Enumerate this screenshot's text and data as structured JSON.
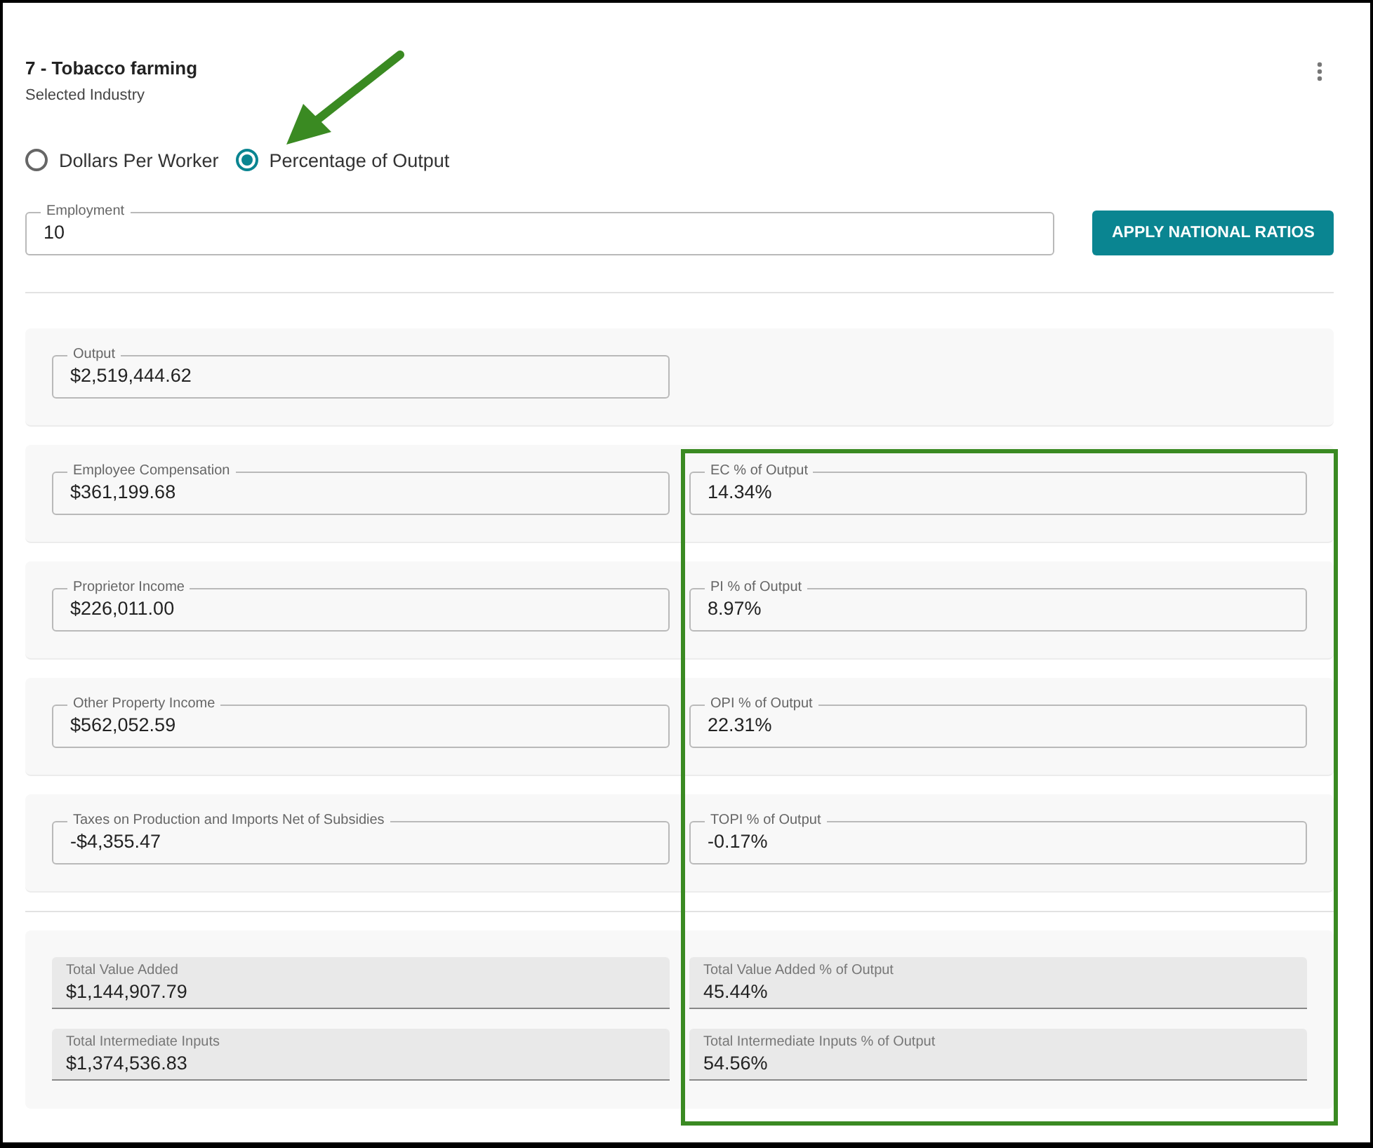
{
  "header": {
    "title": "7 - Tobacco farming",
    "subtitle": "Selected Industry"
  },
  "mode_options": [
    {
      "label": "Dollars Per Worker",
      "selected": false
    },
    {
      "label": "Percentage of Output",
      "selected": true
    }
  ],
  "employment": {
    "label": "Employment",
    "value": "10"
  },
  "apply_button": "APPLY NATIONAL RATIOS",
  "output": {
    "label": "Output",
    "value": "$2,519,444.62"
  },
  "components": [
    {
      "amount": {
        "label": "Employee Compensation",
        "value": "$361,199.68"
      },
      "share": {
        "label": "EC % of Output",
        "value": "14.34%"
      }
    },
    {
      "amount": {
        "label": "Proprietor Income",
        "value": "$226,011.00"
      },
      "share": {
        "label": "PI % of Output",
        "value": "8.97%"
      }
    },
    {
      "amount": {
        "label": "Other Property Income",
        "value": "$562,052.59"
      },
      "share": {
        "label": "OPI % of Output",
        "value": "22.31%"
      }
    },
    {
      "amount": {
        "label": "Taxes on Production and Imports Net of Subsidies",
        "value": "-$4,355.47"
      },
      "share": {
        "label": "TOPI % of Output",
        "value": "-0.17%"
      }
    }
  ],
  "totals": [
    {
      "amount": {
        "label": "Total Value Added",
        "value": "$1,144,907.79"
      },
      "share": {
        "label": "Total Value Added % of Output",
        "value": "45.44%"
      }
    },
    {
      "amount": {
        "label": "Total Intermediate Inputs",
        "value": "$1,374,536.83"
      },
      "share": {
        "label": "Total Intermediate Inputs % of Output",
        "value": "54.56%"
      }
    }
  ],
  "annotations": {
    "arrow": true,
    "highlight": true
  }
}
